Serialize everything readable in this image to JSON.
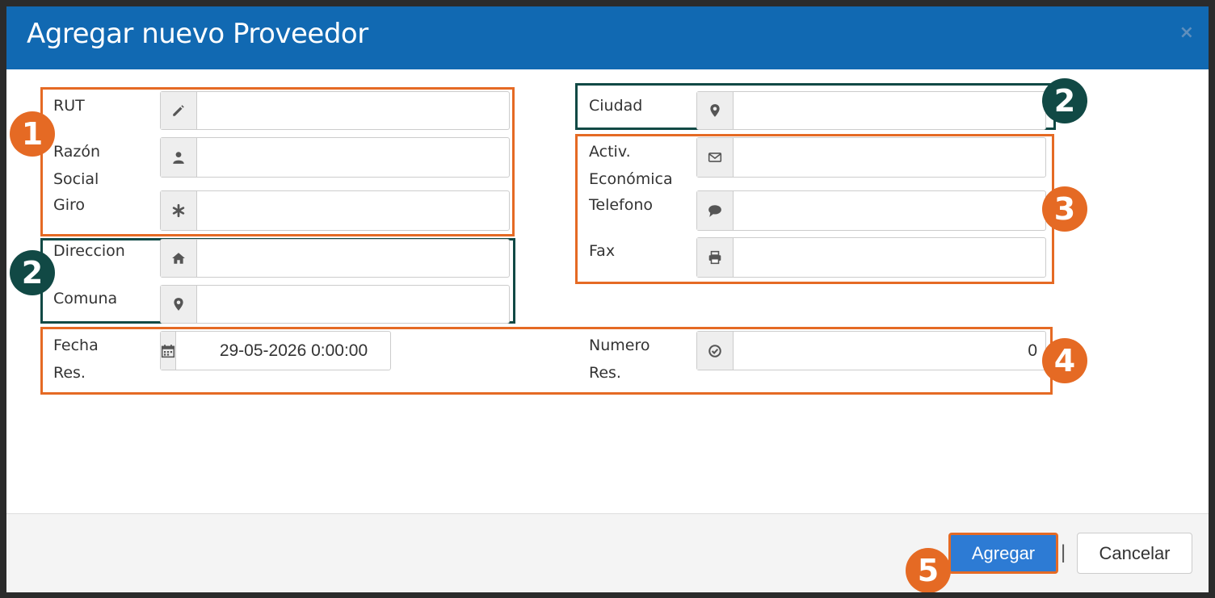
{
  "dialog": {
    "title": "Agregar nuevo Proveedor",
    "close": "×"
  },
  "fields": {
    "rut": {
      "label": "RUT",
      "value": ""
    },
    "razon_social": {
      "label_line1": "Razón",
      "label_line2": "Social",
      "value": ""
    },
    "giro": {
      "label": "Giro",
      "value": ""
    },
    "direccion": {
      "label": "Direccion",
      "value": ""
    },
    "comuna": {
      "label": "Comuna",
      "value": ""
    },
    "ciudad": {
      "label": "Ciudad",
      "value": ""
    },
    "actividad": {
      "label_line1": "Activ.",
      "label_line2": "Económica",
      "value": ""
    },
    "telefono": {
      "label": "Telefono",
      "value": ""
    },
    "fax": {
      "label": "Fax",
      "value": ""
    },
    "fecha_res": {
      "label_line1": "Fecha",
      "label_line2": "Res.",
      "value": "29-05-2026 0:00:00"
    },
    "numero_res": {
      "label_line1": "Numero",
      "label_line2": "Res.",
      "value": "0"
    }
  },
  "icons": {
    "rut": "pencil-icon",
    "razon_social": "user-icon",
    "giro": "asterisk-icon",
    "direccion": "home-icon",
    "comuna": "map-marker-icon",
    "ciudad": "map-marker-icon",
    "actividad": "envelope-icon",
    "telefono": "comment-icon",
    "fax": "print-icon",
    "fecha_res": "calendar-icon",
    "numero_res": "check-circle-icon"
  },
  "annotations": {
    "badge1": "1",
    "badge2_left": "2",
    "badge2_right": "2",
    "badge3": "3",
    "badge4": "4",
    "badge5": "5"
  },
  "footer": {
    "add_label": "Agregar",
    "separator": "|",
    "cancel_label": "Cancelar"
  },
  "colors": {
    "header": "#1169b2",
    "highlight_orange": "#e56a24",
    "highlight_dark": "#114945",
    "primary_button": "#2d7bd4"
  }
}
